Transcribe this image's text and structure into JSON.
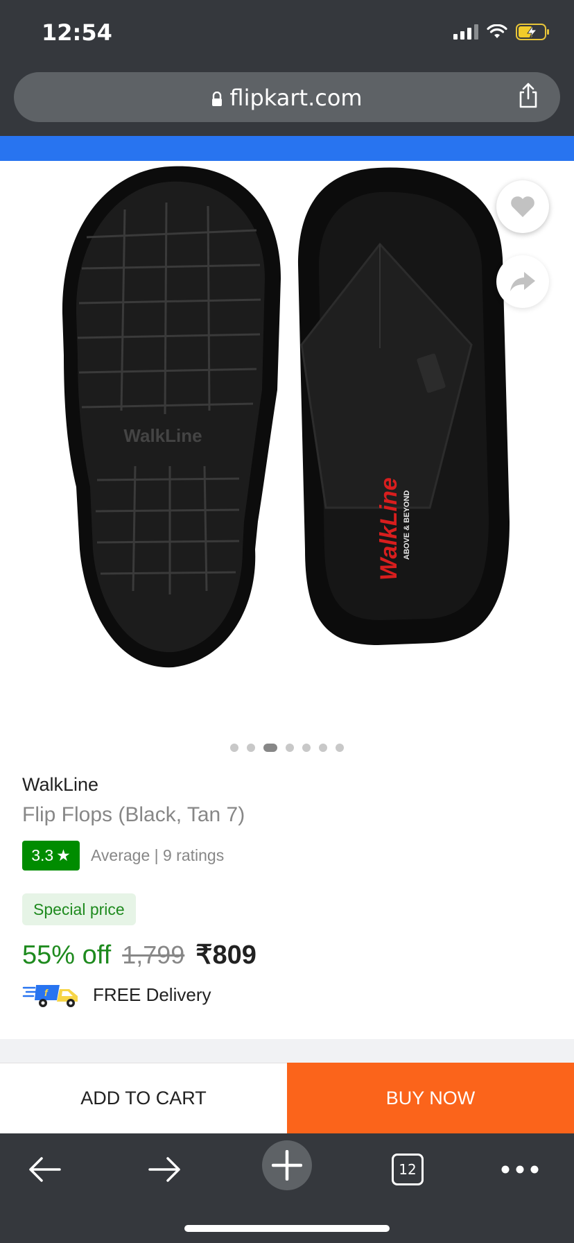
{
  "status_bar": {
    "time": "12:54"
  },
  "browser": {
    "url": "flipkart.com",
    "tab_count": "12"
  },
  "product": {
    "image_count": 7,
    "active_image_index": 2,
    "brand": "WalkLine",
    "title": "Flip Flops (Black, Tan 7)",
    "rating": "3.3",
    "rating_star": "★",
    "rating_summary": "Average | 9 ratings",
    "special_label": "Special price",
    "discount": "55% off",
    "mrp": "1,799",
    "price": "₹809",
    "delivery": "FREE Delivery",
    "image_logo_text_left": "WalkLine",
    "image_logo_text_right": "WalkLine",
    "image_logo_tagline": "ABOVE & BEYOND"
  },
  "actions": {
    "add_to_cart": "ADD TO CART",
    "buy_now": "BUY NOW"
  },
  "colors": {
    "chrome_bg": "#35383d",
    "url_bar_bg": "#5e6266",
    "flipkart_blue": "#2874f0",
    "buy_now_orange": "#fb641b",
    "rating_green": "#008c00",
    "discount_green": "#1e8a1e"
  },
  "icons": [
    "lock-icon",
    "share-icon",
    "heart-icon",
    "forward-share-icon",
    "back-arrow-icon",
    "forward-arrow-icon",
    "new-tab-plus-icon",
    "tabs-icon",
    "more-icon",
    "delivery-truck-icon"
  ]
}
